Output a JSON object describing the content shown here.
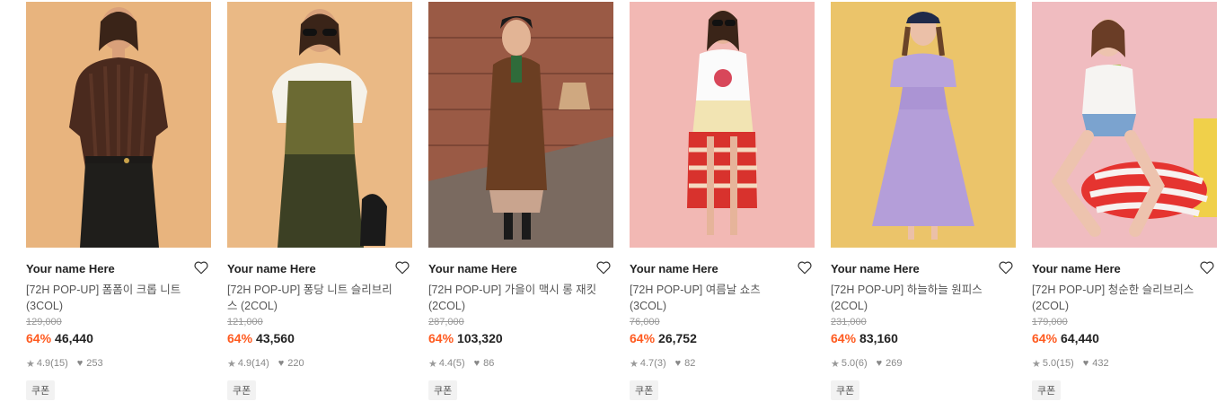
{
  "products": [
    {
      "brand": "Your name Here",
      "title": "[72H POP-UP] 폼폼이 크롭 니트 (3COL)",
      "original_price": "129,000",
      "discount": "64%",
      "price": "46,440",
      "rating": "4.9",
      "reviews": "(15)",
      "likes": "253",
      "coupon": "쿠폰",
      "bg": "#e8b47e"
    },
    {
      "brand": "Your name Here",
      "title": "[72H POP-UP] 퐁당 니트 슬리브리스 (2COL)",
      "original_price": "121,000",
      "discount": "64%",
      "price": "43,560",
      "rating": "4.9",
      "reviews": "(14)",
      "likes": "220",
      "coupon": "쿠폰",
      "bg": "#eab985"
    },
    {
      "brand": "Your name Here",
      "title": "[72H POP-UP] 가을이 맥시 롱 재킷 (2COL)",
      "original_price": "287,000",
      "discount": "64%",
      "price": "103,320",
      "rating": "4.4",
      "reviews": "(5)",
      "likes": "86",
      "coupon": "쿠폰",
      "bg": "#9a5a45"
    },
    {
      "brand": "Your name Here",
      "title": "[72H POP-UP] 여름날 쇼츠 (3COL)",
      "original_price": "76,000",
      "discount": "64%",
      "price": "26,752",
      "rating": "4.7",
      "reviews": "(3)",
      "likes": "82",
      "coupon": "쿠폰",
      "bg": "#f2b8b4"
    },
    {
      "brand": "Your name Here",
      "title": "[72H POP-UP] 하늘하늘 원피스 (2COL)",
      "original_price": "231,000",
      "discount": "64%",
      "price": "83,160",
      "rating": "5.0",
      "reviews": "(6)",
      "likes": "269",
      "coupon": "쿠폰",
      "bg": "#ebc46a"
    },
    {
      "brand": "Your name Here",
      "title": "[72H POP-UP] 청순한 슬리브리스 (2COL)",
      "original_price": "179,000",
      "discount": "64%",
      "price": "64,440",
      "rating": "5.0",
      "reviews": "(15)",
      "likes": "432",
      "coupon": "쿠폰",
      "bg": "#f0bcc0"
    }
  ],
  "icons": {
    "wishlist": "heart-outline-icon",
    "rating": "star-icon",
    "likes": "heart-icon"
  },
  "colors": {
    "discount": "#ff5a1f",
    "text": "#222222",
    "muted": "#888888"
  }
}
